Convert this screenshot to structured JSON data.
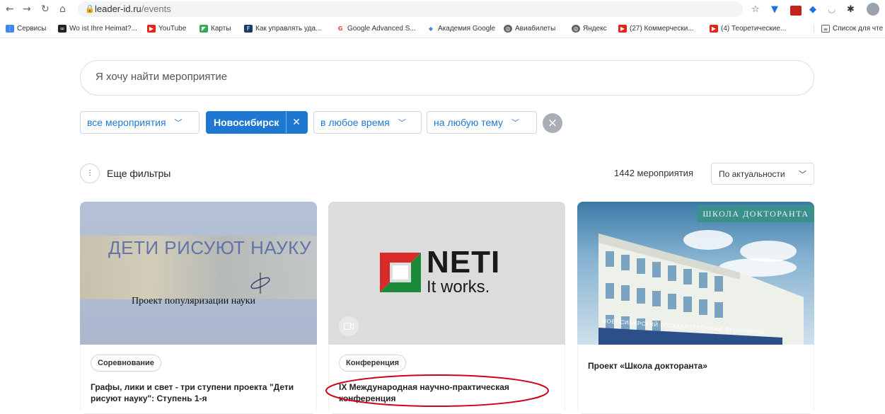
{
  "browser": {
    "url_host": "leader-id.ru",
    "url_path": "/events",
    "bookmarks": [
      {
        "label": "Сервисы",
        "color": "#4285f4"
      },
      {
        "label": "Wo ist Ihre Heimat?...",
        "color": "#222222"
      },
      {
        "label": "YouTube",
        "color": "#e62117"
      },
      {
        "label": "Карты",
        "color": "#34a853"
      },
      {
        "label": "Как управлять уда...",
        "color": "#1b3a6b"
      },
      {
        "label": "Google Advanced S...",
        "color": "#ea4335"
      },
      {
        "label": "Академия Google",
        "color": "#4285f4"
      },
      {
        "label": "Авиабилеты",
        "color": "#5f6368"
      },
      {
        "label": "Яндекс",
        "color": "#5f6368"
      },
      {
        "label": "(27) Коммерчески...",
        "color": "#e62117"
      },
      {
        "label": "(4) Теоретические...",
        "color": "#e62117"
      },
      {
        "label": "Список для чте",
        "color": "#5f6368"
      }
    ]
  },
  "search": {
    "placeholder": "Я хочу найти мероприятие"
  },
  "filters": {
    "type": "все мероприятия",
    "city": "Новосибирск",
    "time": "в любое время",
    "topic": "на любую тему",
    "more": "Еще фильтры"
  },
  "results": {
    "count": "1442 мероприятия",
    "sort": "По актуальности"
  },
  "cards": [
    {
      "cover_title": "ДЕТИ РИСУЮТ НАУКУ",
      "cover_subtitle": "Проект популяризации науки",
      "tag": "Соревнование",
      "title": "Графы, лики и свет - три ступени проекта \"Дети рисуют науку\": Ступень 1-я"
    },
    {
      "cover_logo": "NETI",
      "cover_tagline": "It works.",
      "tag": "Конференция",
      "title": "IX Международная научно-практическая конференция"
    },
    {
      "cover_banner": "ШКОЛА ДОКТОРАНТА",
      "cover_sign": "НОВОСИБИРСКИЙ ГОСУДАРСТВЕННЫЙ ЭКОНОМИЧЕСКИЙ",
      "title": "Проект «Школа докторанта»"
    }
  ],
  "icons": {
    "back": "arrow-left-icon",
    "forward": "arrow-right-icon",
    "reload": "reload-icon",
    "home": "home-icon",
    "lock": "lock-icon",
    "star": "star-icon",
    "filters": "sliders-icon",
    "clear": "close-icon",
    "video": "video-camera-icon"
  },
  "colors": {
    "accent": "#1e78d2",
    "annotation": "#d0021b"
  }
}
